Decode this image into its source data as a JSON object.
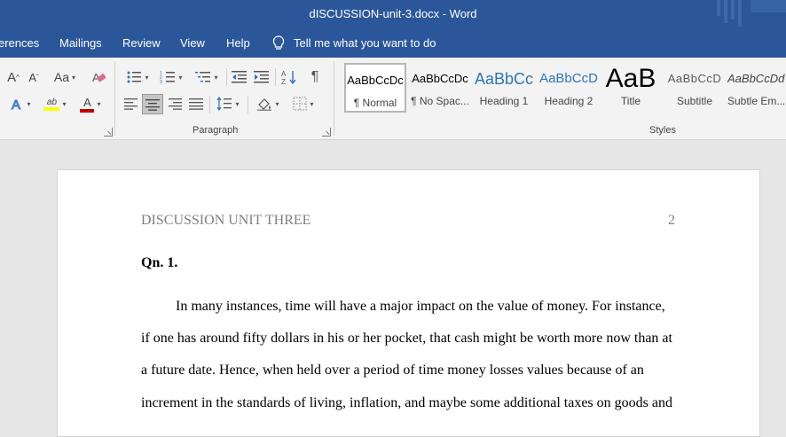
{
  "window": {
    "title": "dISCUSSION-unit-3.docx  -  Word"
  },
  "tabs": [
    "erences",
    "Mailings",
    "Review",
    "View",
    "Help"
  ],
  "tell_me": {
    "text": "Tell me what you want to do"
  },
  "ribbon": {
    "paragraph_label": "Paragraph",
    "styles_label": "Styles",
    "font_buttons": {
      "grow_font": "A",
      "shrink_font": "A",
      "change_case": "Aa",
      "text_effects": "A",
      "highlight": "ab",
      "font_color": "A",
      "highlight_color": "#ffff00",
      "font_color_value": "#c00000"
    },
    "styles": [
      {
        "preview": "AaBbCcDc",
        "name": "¶ Normal"
      },
      {
        "preview": "AaBbCcDc",
        "name": "¶ No Spac..."
      },
      {
        "preview": "AaBbCc",
        "name": "Heading 1"
      },
      {
        "preview": "AaBbCcD",
        "name": "Heading 2"
      },
      {
        "preview": "AaB",
        "name": "Title"
      },
      {
        "preview": "AaBbCcD",
        "name": "Subtitle"
      },
      {
        "preview": "AaBbCcDd",
        "name": "Subtle Em..."
      }
    ]
  },
  "document": {
    "header_left": "DISCUSSION UNIT THREE",
    "header_page": "2",
    "heading": "Qn. 1.",
    "lines": [
      "In many instances, time will have a major impact on the value of money. For instance,",
      "if one has around fifty dollars in his or her pocket, that cash might be worth more now than at",
      "a future date. Hence, when held over a period of time money losses values because of an",
      "increment in the standards of living, inflation, and maybe some additional taxes on goods and"
    ]
  },
  "colors": {
    "accent": "#2b579a",
    "ribbon_bg": "#f3f3f3",
    "canvas_bg": "#e6e6e6",
    "heading1_color": "#2e74b5",
    "header_text": "#7f7f7f"
  }
}
